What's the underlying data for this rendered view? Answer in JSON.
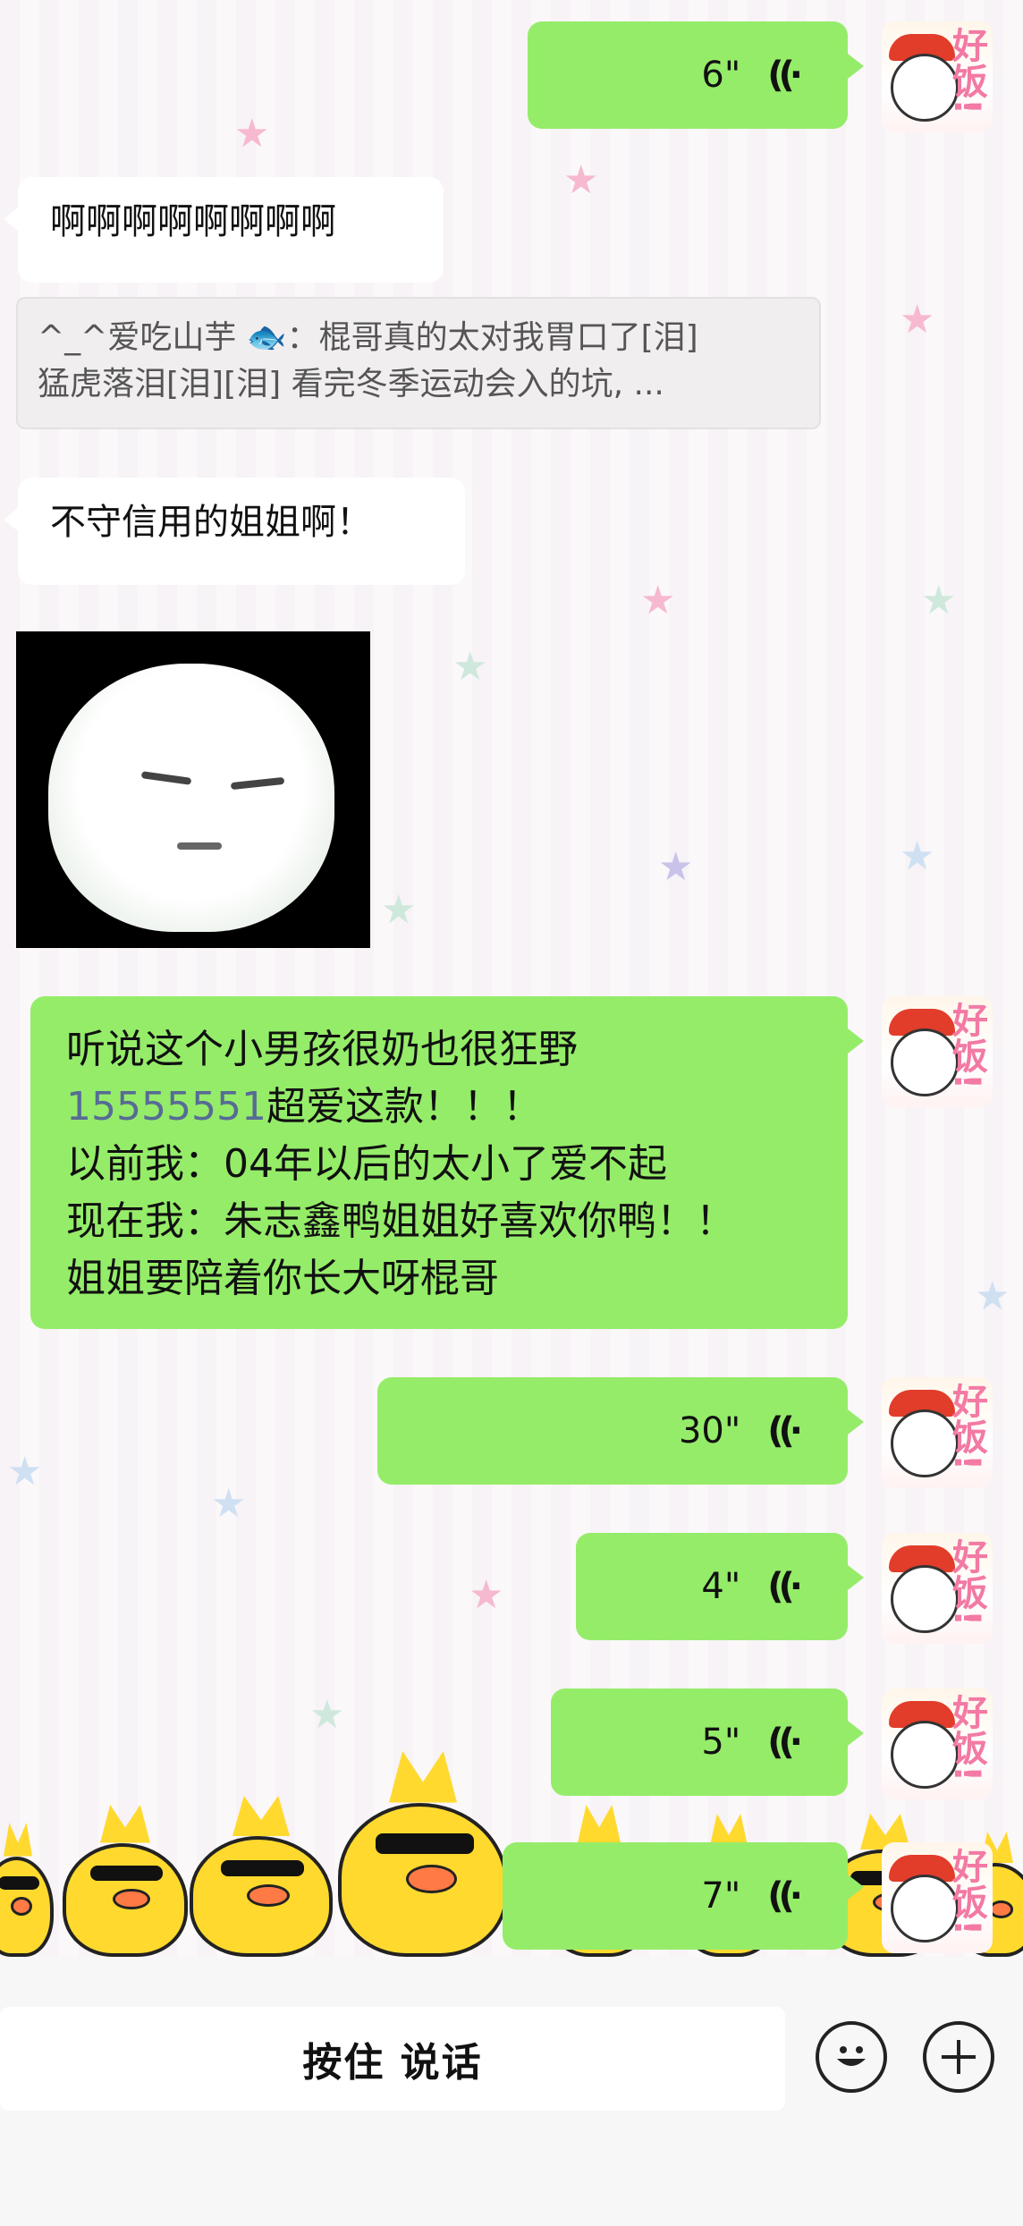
{
  "messages": {
    "voice1": {
      "duration": "6\""
    },
    "text1": "啊啊啊啊啊啊啊啊",
    "quote": {
      "line1": "^_^爱吃山芋 🐟：棍哥真的太对我胃口了[泪]",
      "line2": "猛虎落泪[泪][泪] 看完冬季运动会入的坑, ..."
    },
    "text2": "不守信用的姐姐啊！",
    "long": {
      "line1": "听说这个小男孩很奶也很狂野",
      "line2_link": "15555551",
      "line2_rest": "超爱这款！！！",
      "line3": "以前我：04年以后的太小了爱不起",
      "line4": "现在我：朱志鑫鸭姐姐好喜欢你鸭！！",
      "line5": "姐姐要陪着你长大呀棍哥"
    },
    "voice2": {
      "duration": "30\""
    },
    "voice3": {
      "duration": "4\""
    },
    "voice4": {
      "duration": "5\""
    },
    "voice5": {
      "duration": "7\""
    }
  },
  "avatar": {
    "text": "好饭!"
  },
  "icons": {
    "voice": "voice-wave-icon",
    "emoji": "smiley-icon",
    "plus": "plus-icon"
  },
  "input_bar": {
    "talk_label": "按住 说话"
  },
  "colors": {
    "bubble_out": "#95ec69",
    "bubble_in": "#ffffff",
    "link": "#576b95",
    "duck": "#ffd92e"
  }
}
